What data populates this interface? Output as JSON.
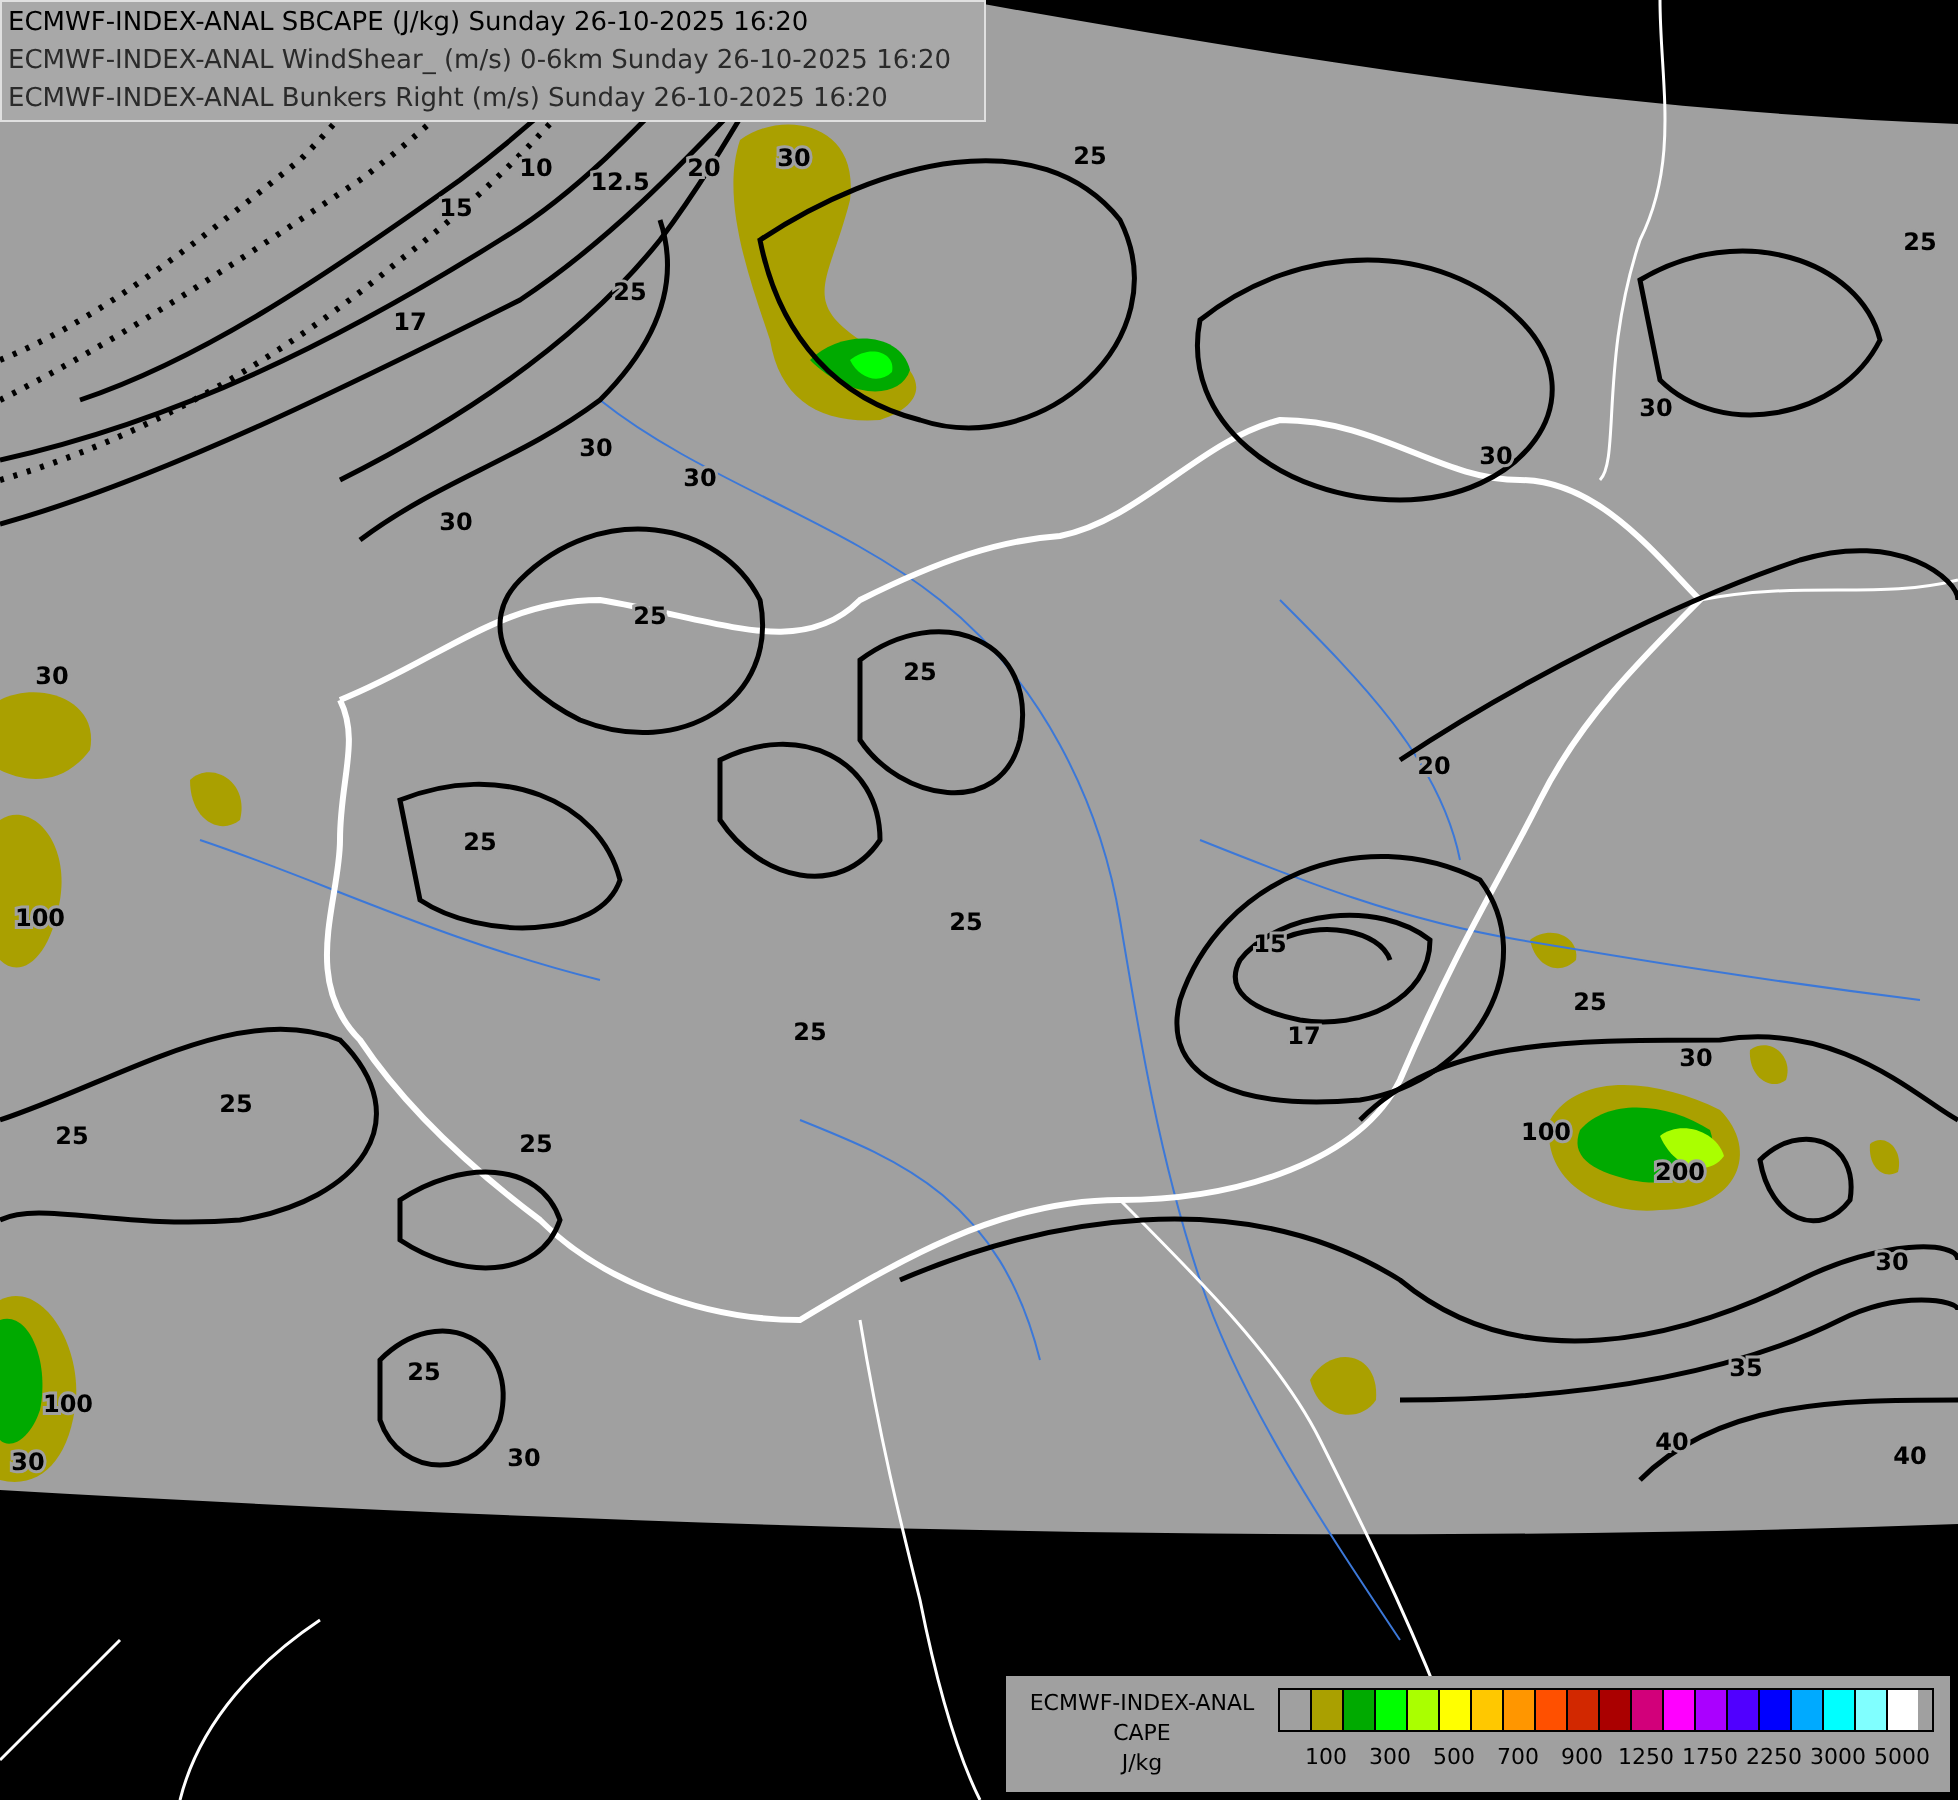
{
  "header": {
    "lines": [
      "ECMWF-INDEX-ANAL SBCAPE (J/kg) Sunday 26-10-2025 16:20",
      "ECMWF-INDEX-ANAL WindShear_ (m/s) 0-6km Sunday 26-10-2025 16:20",
      "ECMWF-INDEX-ANAL Bunkers Right (m/s) Sunday 26-10-2025 16:20"
    ]
  },
  "map": {
    "contour_labels": [
      "10",
      "12.5",
      "20",
      "15",
      "25",
      "17",
      "30",
      "30",
      "30",
      "25",
      "25",
      "30",
      "25",
      "25",
      "25",
      "15",
      "17",
      "20",
      "30",
      "30",
      "25",
      "25",
      "30",
      "25",
      "30",
      "100",
      "200",
      "25",
      "25",
      "25",
      "25",
      "30",
      "35",
      "40",
      "40",
      "30",
      "100",
      "30",
      "100"
    ]
  },
  "legend": {
    "title_lines": [
      "ECMWF-INDEX-ANAL",
      "CAPE",
      "J/kg"
    ],
    "swatches": [
      {
        "color": "#a0a0a0"
      },
      {
        "color": "#aaa000"
      },
      {
        "color": "#00aa00"
      },
      {
        "color": "#00ff00"
      },
      {
        "color": "#aaff00"
      },
      {
        "color": "#ffff00"
      },
      {
        "color": "#ffc800"
      },
      {
        "color": "#ff9600"
      },
      {
        "color": "#ff5000"
      },
      {
        "color": "#d22800"
      },
      {
        "color": "#aa0000"
      },
      {
        "color": "#d2007a"
      },
      {
        "color": "#ff00ff"
      },
      {
        "color": "#aa00ff"
      },
      {
        "color": "#5000ff"
      },
      {
        "color": "#0000ff"
      },
      {
        "color": "#00aaff"
      },
      {
        "color": "#00ffff"
      },
      {
        "color": "#80ffff"
      },
      {
        "color": "#ffffff"
      }
    ],
    "ticks": [
      "100",
      "300",
      "500",
      "700",
      "900",
      "1250",
      "1750",
      "2250",
      "3000",
      "5000"
    ]
  }
}
